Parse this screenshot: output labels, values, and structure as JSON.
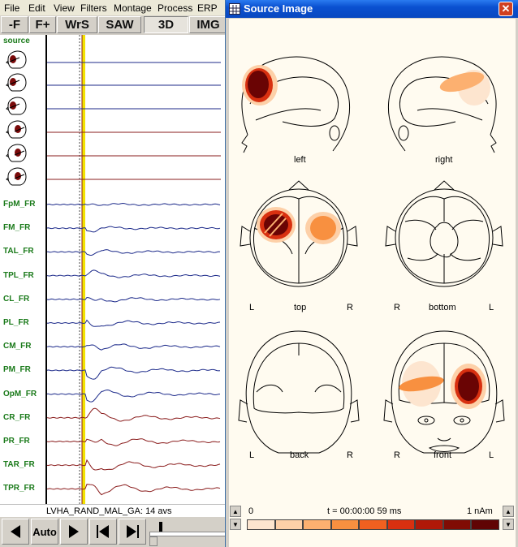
{
  "menu": [
    "File",
    "Edit",
    "View",
    "Filters",
    "Montage",
    "Process",
    "ERP"
  ],
  "toolbar": {
    "buttons": [
      "-F",
      "F+",
      "WrS",
      "SAW",
      "3D",
      "IMG"
    ]
  },
  "channels": {
    "source_label": "source",
    "labels": [
      "FpM_FR",
      "FM_FR",
      "TAL_FR",
      "TPL_FR",
      "CL_FR",
      "PL_FR",
      "CM_FR",
      "PM_FR",
      "OpM_FR",
      "CR_FR",
      "PR_FR",
      "TAR_FR",
      "TPR_FR"
    ]
  },
  "status": "LVHA_RAND_MAL_GA: 14 avs",
  "bottombar": {
    "auto_label": "Auto"
  },
  "source_window": {
    "title": "Source Image",
    "close_symbol": "✕",
    "views": {
      "left": "left",
      "right": "right",
      "top": "top",
      "bottom": "bottom",
      "back": "back",
      "front": "front"
    },
    "orient": {
      "L": "L",
      "R": "R"
    },
    "scale": {
      "min": "0",
      "time": "t = 00:00:00  59 ms",
      "max": "1 nAm"
    }
  },
  "colors": {
    "trace_blue": "#1c2a8a",
    "trace_red": "#8a1c1c",
    "marker_yellow": "#f2e200",
    "colorbar": [
      "#fde5cf",
      "#fdd0a8",
      "#fcb070",
      "#f89040",
      "#f06020",
      "#d83010",
      "#b01808",
      "#800c04",
      "#600404"
    ]
  }
}
